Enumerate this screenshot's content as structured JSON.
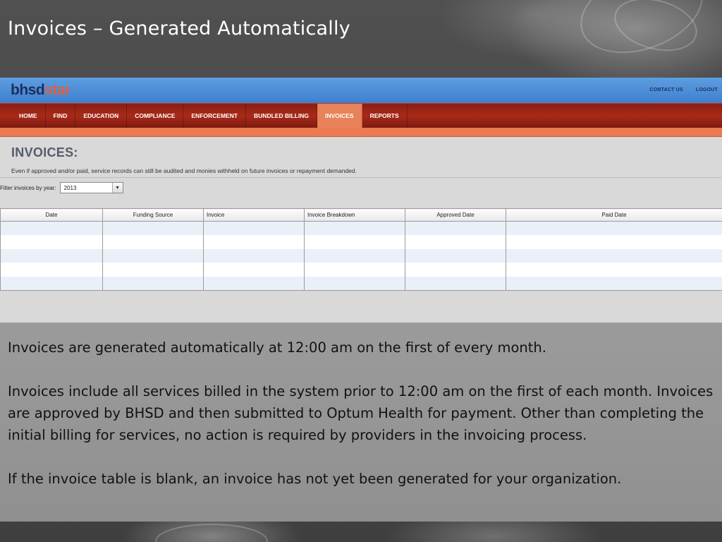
{
  "slide": {
    "title": "Invoices – Generated Automatically"
  },
  "app": {
    "logo": {
      "part1": "bhsd",
      "part2": "star"
    },
    "top_links": [
      "CONTACT US",
      "LOGOUT"
    ],
    "nav": [
      {
        "label": "HOME",
        "active": false
      },
      {
        "label": "FIND",
        "active": false
      },
      {
        "label": "EDUCATION",
        "active": false
      },
      {
        "label": "COMPLIANCE",
        "active": false
      },
      {
        "label": "ENFORCEMENT",
        "active": false
      },
      {
        "label": "BUNDLED BILLING",
        "active": false
      },
      {
        "label": "INVOICES",
        "active": true
      },
      {
        "label": "REPORTS",
        "active": false
      }
    ],
    "page_heading": "INVOICES:",
    "page_description": "Even if approved and/or paid, service records can still be audited and monies withheld on future invoices or repayment demanded.",
    "filter": {
      "label": "Filter invoices by year:",
      "selected": "2013"
    },
    "table": {
      "columns": [
        "Date",
        "Funding Source",
        "Invoice",
        "Invoice Breakdown",
        "Approved Date",
        "Paid Date"
      ],
      "rows": [
        [
          "",
          "",
          "",
          "",
          "",
          ""
        ],
        [
          "",
          "",
          "",
          "",
          "",
          ""
        ],
        [
          "",
          "",
          "",
          "",
          "",
          ""
        ],
        [
          "",
          "",
          "",
          "",
          "",
          ""
        ],
        [
          "",
          "",
          "",
          "",
          "",
          ""
        ]
      ]
    }
  },
  "notes": [
    "Invoices are generated automatically at 12:00 am on the first of every month.",
    "Invoices include all services billed in the system prior to 12:00 am on the first of each month. Invoices are approved by BHSD and then submitted to Optum Health for payment. Other than completing the initial billing for services, no action is required by providers in the invoicing process.",
    "If the invoice table is blank, an invoice has not yet been generated for your organization."
  ]
}
